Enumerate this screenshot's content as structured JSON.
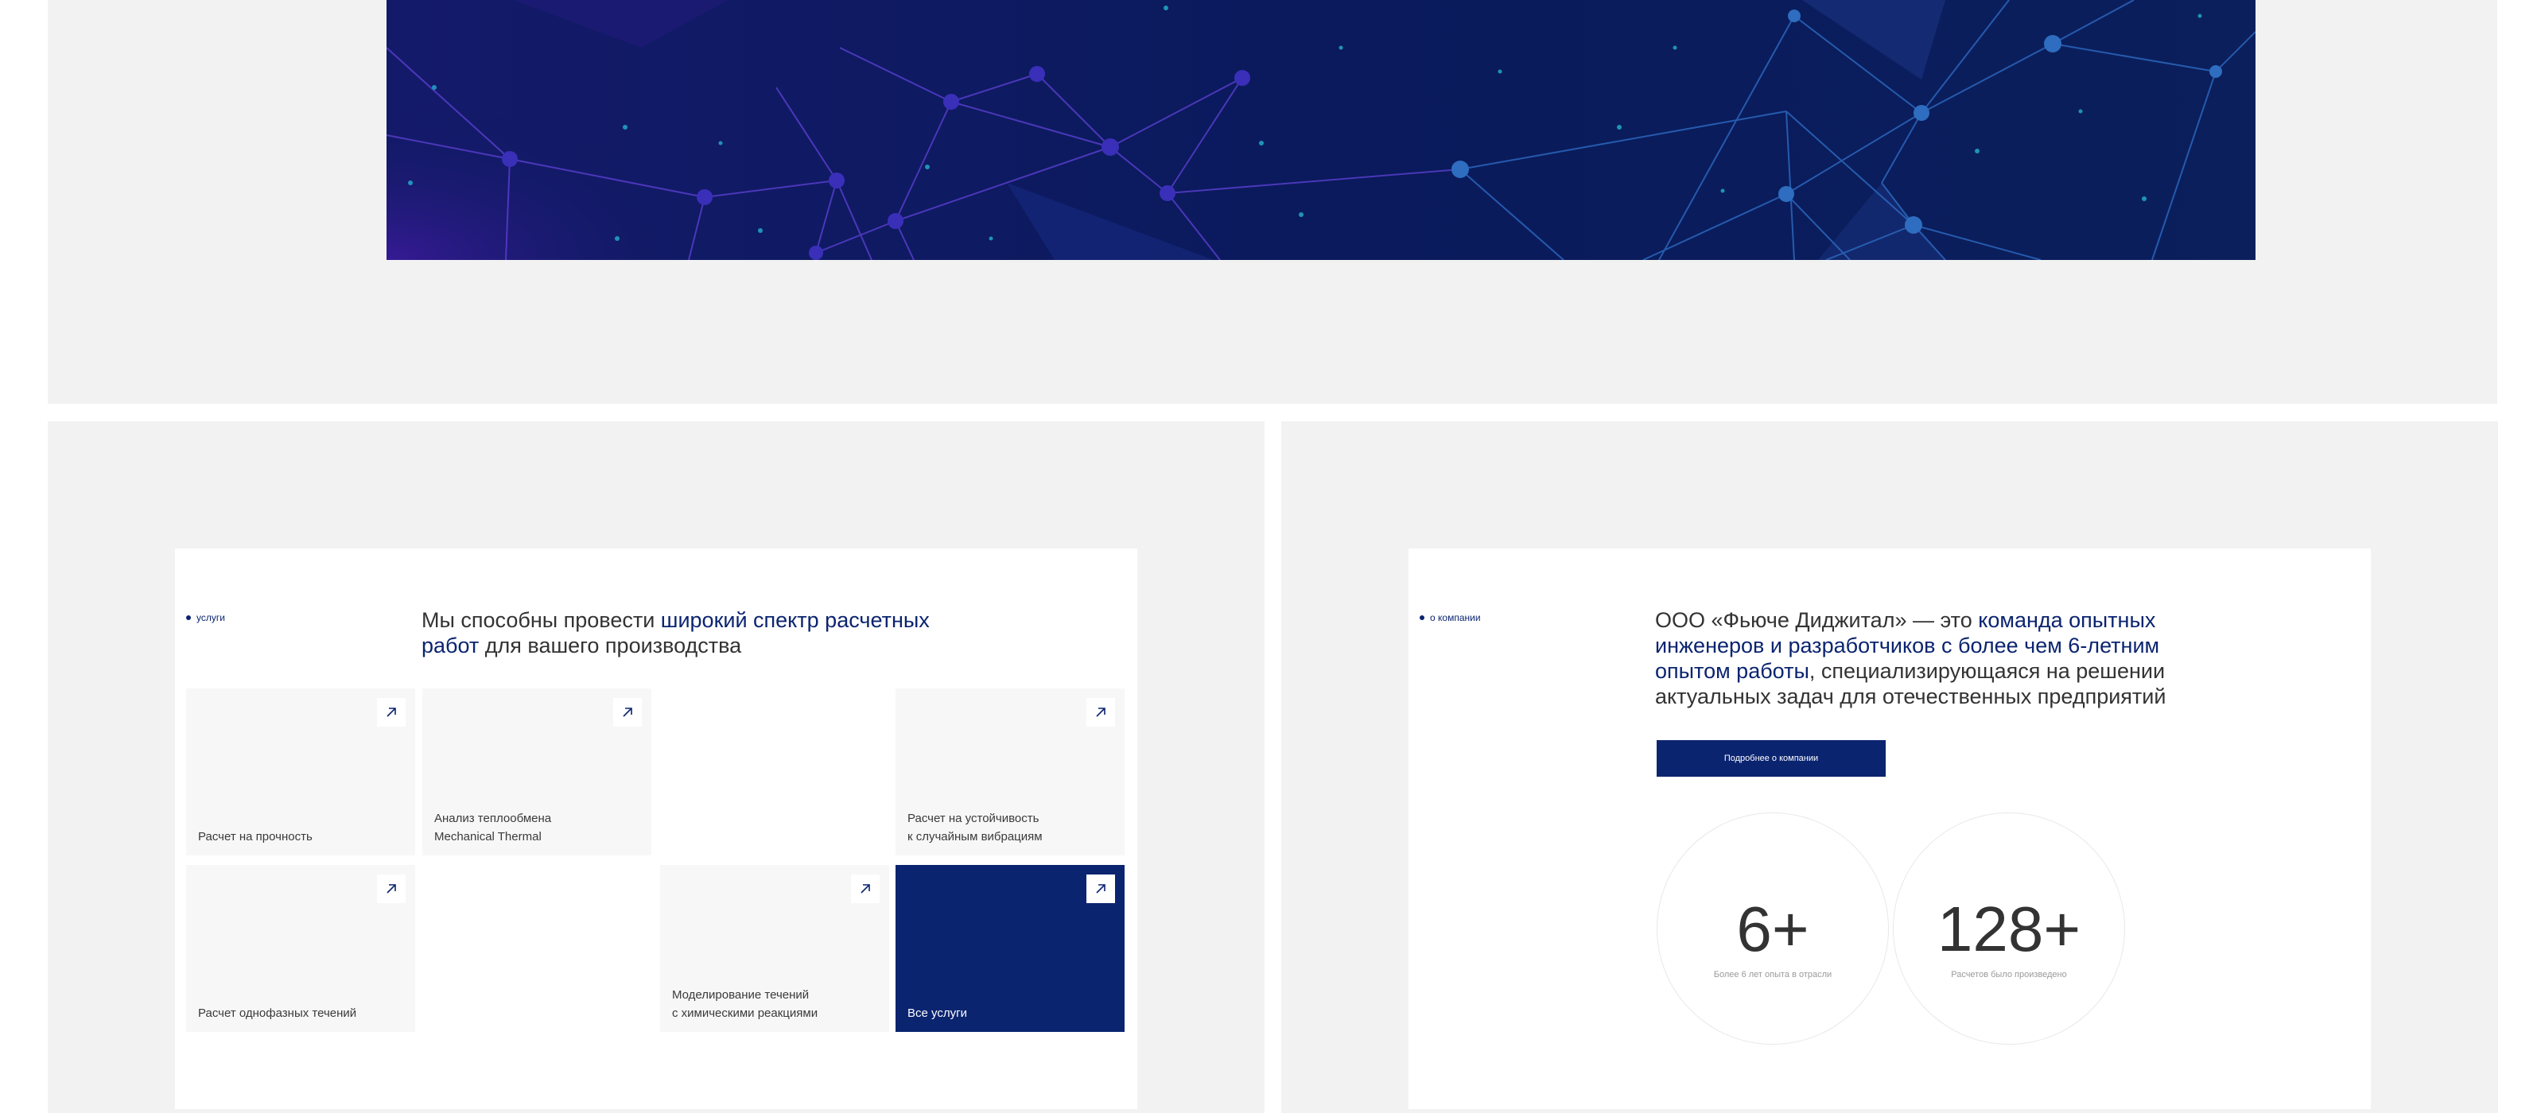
{
  "services": {
    "tag": "услуги",
    "headline_pre": "Мы способны провести ",
    "headline_accent": "широкий спектр расчетных работ",
    "headline_post": " для вашего производства",
    "items": [
      {
        "label": "Расчет на прочность"
      },
      {
        "label": "Анализ теплообмена\nMechanical Thermal"
      },
      {
        "label": "Расчет на устойчивость\nк случайным вибрациям"
      },
      {
        "label": "Расчет однофазных течений"
      },
      {
        "label": "Моделирование течений\nс химическими реакциями"
      },
      {
        "label": "Все услуги"
      }
    ],
    "arrow_icon": "arrow-up-right-icon"
  },
  "about": {
    "tag": "о компании",
    "headline_pre": "ООО «Фьюче Диджитал» — это ",
    "headline_accent": "команда опытных инженеров и разработчиков с более чем 6-летним опытом работы",
    "headline_post": ", специализирующаяся на решении актуальных задач для отечественных предприятий",
    "button_label": "Подробнее о компании",
    "stats": [
      {
        "value": "6+",
        "desc": "Более 6 лет опыта в отрасли"
      },
      {
        "value": "128+",
        "desc": "Расчетов было произведено"
      }
    ]
  },
  "colors": {
    "accent": "#0b2470",
    "panel_bg": "#f2f2f2",
    "hero_bg": "#0a1a5c"
  }
}
